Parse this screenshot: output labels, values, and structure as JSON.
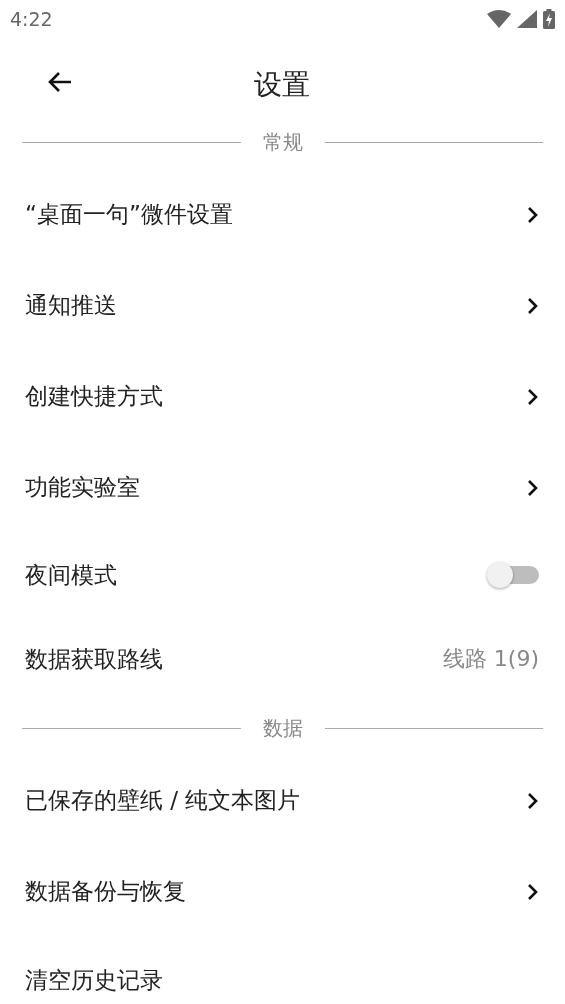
{
  "status_bar": {
    "time": "4:22"
  },
  "header": {
    "title": "设置"
  },
  "sections": [
    {
      "title": "常规",
      "items": [
        {
          "kind": "link",
          "label": "“桌面一句”微件设置"
        },
        {
          "kind": "link",
          "label": "通知推送"
        },
        {
          "kind": "link",
          "label": "创建快捷方式"
        },
        {
          "kind": "link",
          "label": "功能实验室"
        },
        {
          "kind": "toggle",
          "label": "夜间模式",
          "on": false
        },
        {
          "kind": "value",
          "label": "数据获取路线",
          "value": "线路 1(9)"
        }
      ]
    },
    {
      "title": "数据",
      "items": [
        {
          "kind": "link",
          "label": "已保存的壁纸 / 纯文本图片"
        },
        {
          "kind": "link",
          "label": "数据备份与恢复"
        },
        {
          "kind": "plain",
          "label": "清空历史记录"
        }
      ]
    }
  ]
}
